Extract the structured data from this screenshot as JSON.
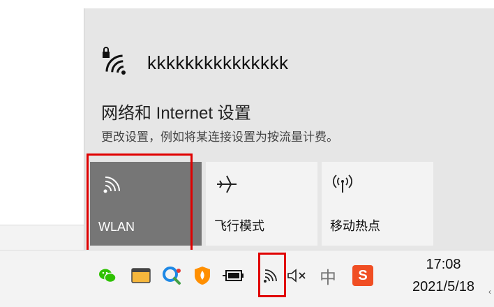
{
  "network": {
    "name": "kkkkkkkkkkkkkkk"
  },
  "settings": {
    "title": "网络和 Internet 设置",
    "description": "更改设置，例如将某连接设置为按流量计费。"
  },
  "quick_actions": [
    {
      "label": "WLAN",
      "icon": "wifi-icon",
      "active": true
    },
    {
      "label": "飞行模式",
      "icon": "airplane-icon",
      "active": false
    },
    {
      "label": "移动热点",
      "icon": "hotspot-icon",
      "active": false
    }
  ],
  "tray": {
    "icons": [
      "wechat-icon",
      "app-window-icon",
      "search-app-icon",
      "shield-app-icon",
      "battery-plug-icon",
      "wifi-icon",
      "speaker-muted-icon",
      "input-method-icon",
      "sogou-icon"
    ],
    "ime_label": "中",
    "sogou_label": "S"
  },
  "clock": {
    "time": "17:08",
    "date": "2021/5/18"
  },
  "colors": {
    "highlight": "#e00000",
    "tile_active": "#767676",
    "flyout_bg": "#e6e6e6"
  }
}
